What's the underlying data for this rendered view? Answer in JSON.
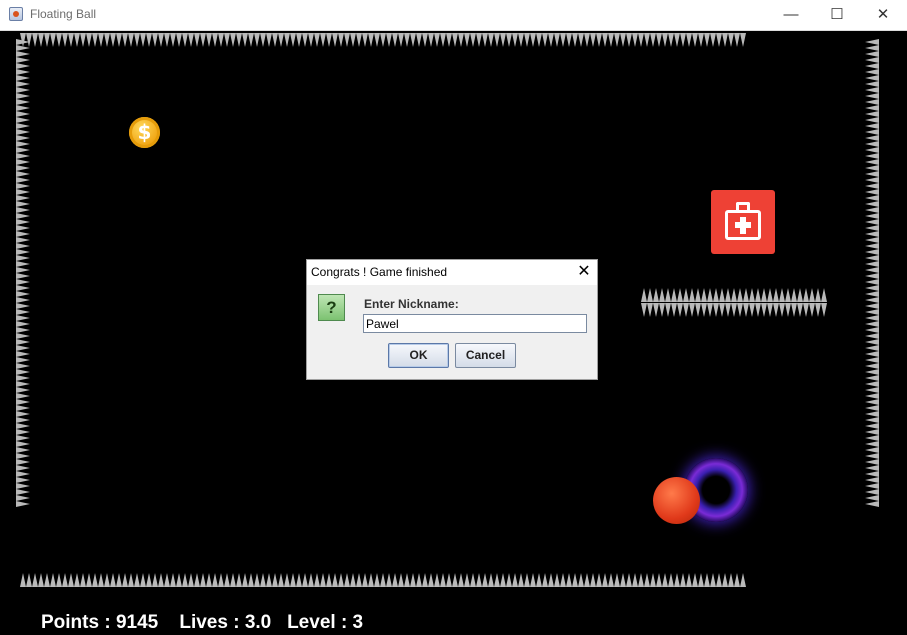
{
  "window": {
    "title": "Floating Ball",
    "minimize_glyph": "—",
    "maximize_glyph": "☐",
    "close_glyph": "✕"
  },
  "game": {
    "coin_glyph": "$"
  },
  "dialog": {
    "title": "Congrats ! Game finished",
    "close_glyph": "✕",
    "icon_glyph": "?",
    "label": "Enter Nickname:",
    "nickname_value": "Pawel",
    "ok_label": "OK",
    "cancel_label": "Cancel"
  },
  "status": {
    "points": "Points : 9145",
    "lives": "Lives : 3.0",
    "level": "Level : 3"
  }
}
